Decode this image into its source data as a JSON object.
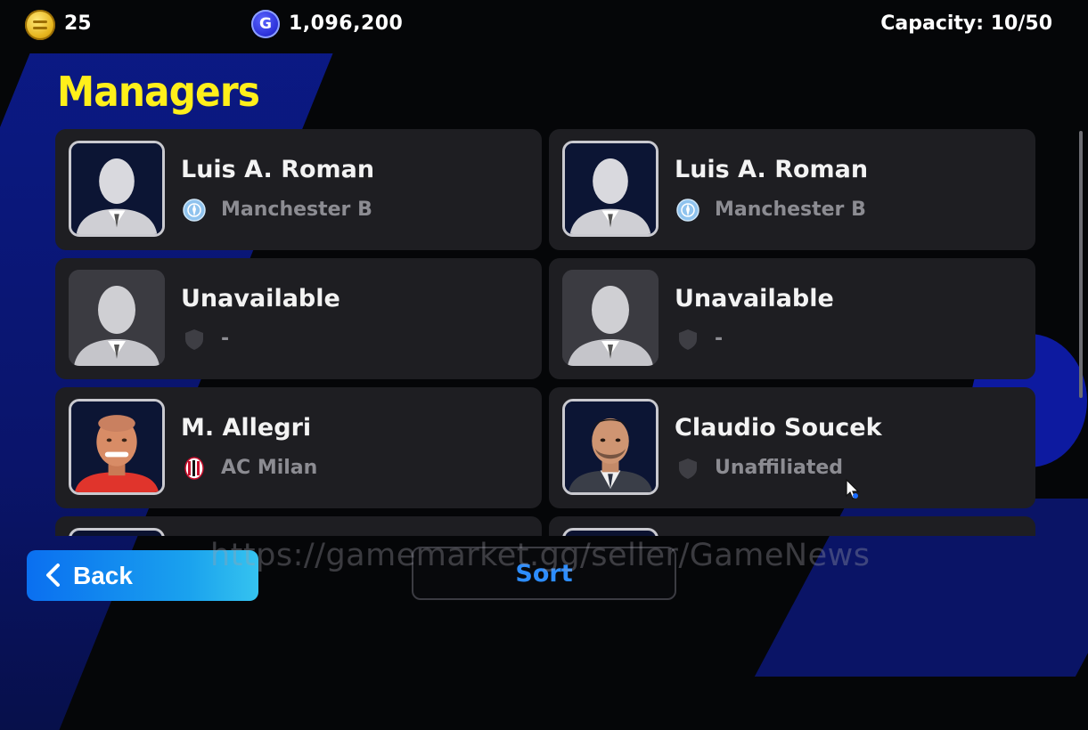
{
  "header": {
    "coins": "25",
    "gp": "1,096,200",
    "gp_icon_letter": "G",
    "capacity": "Capacity: 10/50"
  },
  "page_title": "Managers",
  "managers": [
    {
      "name": "Luis A. Roman",
      "club": "Manchester B",
      "portrait": "silhouette-framed",
      "badge": "manchester-b-crest-icon"
    },
    {
      "name": "Luis A. Roman",
      "club": "Manchester B",
      "portrait": "silhouette-framed",
      "badge": "manchester-b-crest-icon"
    },
    {
      "name": "Unavailable",
      "club": "-",
      "portrait": "silhouette-plain",
      "badge": "shield-icon"
    },
    {
      "name": "Unavailable",
      "club": "-",
      "portrait": "silhouette-plain",
      "badge": "shield-icon"
    },
    {
      "name": "M. Allegri",
      "club": "AC Milan",
      "portrait": "manager-photo",
      "badge": "ac-milan-crest-icon"
    },
    {
      "name": "Claudio Soucek",
      "club": "Unaffiliated",
      "portrait": "manager-photo",
      "badge": "shield-icon"
    }
  ],
  "footer": {
    "back_label": "Back",
    "sort_label": "Sort"
  },
  "watermark": "https://gamemarket.gg/seller/GameNews",
  "colors": {
    "title": "#ffef1a",
    "card": "#1e1e22",
    "back_button": "#0a6ff0",
    "sort_text": "#2d8dff",
    "club_text": "#8c8c92"
  }
}
